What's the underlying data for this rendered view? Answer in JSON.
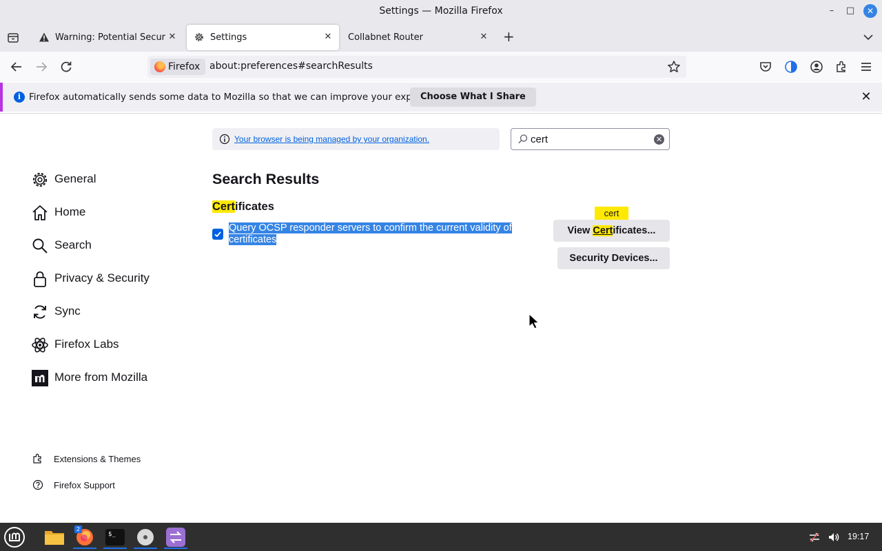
{
  "window": {
    "title": "Settings — Mozilla Firefox",
    "minimize_glyph": "–",
    "maximize_glyph": "□",
    "close_glyph": "✕"
  },
  "tabs": [
    {
      "label": "Warning: Potential Security Risk Ahead",
      "icon": "warning-icon",
      "active": false
    },
    {
      "label": "Settings",
      "icon": "gear-icon",
      "active": true
    },
    {
      "label": "Collabnet Router",
      "icon": "",
      "active": false
    }
  ],
  "tab_close_glyph": "✕",
  "newtab_glyph": "+",
  "urlbar": {
    "identity_label": "Firefox",
    "url": "about:preferences#searchResults"
  },
  "notification": {
    "text": "Firefox automatically sends some data to Mozilla so that we can improve your experience.",
    "button": "Choose What I Share",
    "close_glyph": "✕",
    "info_glyph": "i"
  },
  "sidebar": {
    "categories": [
      {
        "label": "General",
        "icon": "gear-icon"
      },
      {
        "label": "Home",
        "icon": "home-icon"
      },
      {
        "label": "Search",
        "icon": "search-icon"
      },
      {
        "label": "Privacy & Security",
        "icon": "lock-icon"
      },
      {
        "label": "Sync",
        "icon": "sync-icon"
      },
      {
        "label": "Firefox Labs",
        "icon": "labs-icon"
      },
      {
        "label": "More from Mozilla",
        "icon": "mozilla-icon"
      }
    ],
    "footer": [
      {
        "label": "Extensions & Themes",
        "icon": "puzzle-icon"
      },
      {
        "label": "Firefox Support",
        "icon": "help-icon"
      }
    ]
  },
  "policy": {
    "link": "Your browser is being managed by your organization."
  },
  "search": {
    "value": "cert",
    "clear_glyph": "✕"
  },
  "results": {
    "title": "Search Results",
    "section_title_highlight": "Cert",
    "section_title_rest": "ificates",
    "ocsp_label": "Query OCSP responder servers to confirm the current validity of certificates",
    "ocsp_checked": true,
    "view_certificates_pre": "View ",
    "view_certificates_hl": "Cert",
    "view_certificates_post": "ificates...",
    "security_devices": "Security Devices...",
    "highlight_tooltip": "cert"
  },
  "taskbar": {
    "clock": "19:17",
    "firefox_badge": "2",
    "terminal_prompt": "$_"
  },
  "colors": {
    "accent": "#0061e0",
    "highlight": "#ffe900",
    "selection": "#3584e4",
    "notification_stripe": "#b833e1"
  }
}
